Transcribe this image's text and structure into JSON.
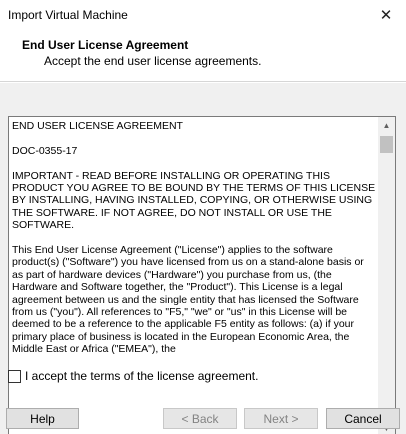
{
  "window": {
    "title": "Import Virtual Machine",
    "close_glyph": "✕"
  },
  "header": {
    "title": "End User License Agreement",
    "subtitle": "Accept the end user license agreements."
  },
  "license": {
    "paragraphs": [
      "END USER LICENSE AGREEMENT",
      "DOC-0355-17",
      "IMPORTANT - READ BEFORE INSTALLING OR OPERATING THIS PRODUCT YOU AGREE TO BE BOUND BY THE TERMS OF THIS LICENSE BY INSTALLING, HAVING INSTALLED, COPYING, OR OTHERWISE USING THE SOFTWARE.  IF NOT AGREE, DO NOT INSTALL OR USE THE SOFTWARE.",
      "This End User License Agreement (\"License\") applies to the software product(s) (\"Software\") you have licensed from us on a stand-alone basis or as part of hardware devices (\"Hardware\") you purchase from us, (the Hardware and Software together, the \"Product\"). This License is a legal agreement between us and the single entity that has licensed the Software from us (\"you\"). All references to \"F5,\" \"we\" or \"us\" in this License will be deemed to be a reference to the applicable F5 entity as follows: (a) if your primary place of business is located in the European Economic Area, the Middle East or Africa (\"EMEA\"), the"
    ],
    "scroll_up_glyph": "▲",
    "scroll_down_glyph": "▼"
  },
  "accept": {
    "label": "I accept the terms of the license agreement."
  },
  "buttons": {
    "help": "Help",
    "back": "< Back",
    "next": "Next >",
    "cancel": "Cancel"
  }
}
